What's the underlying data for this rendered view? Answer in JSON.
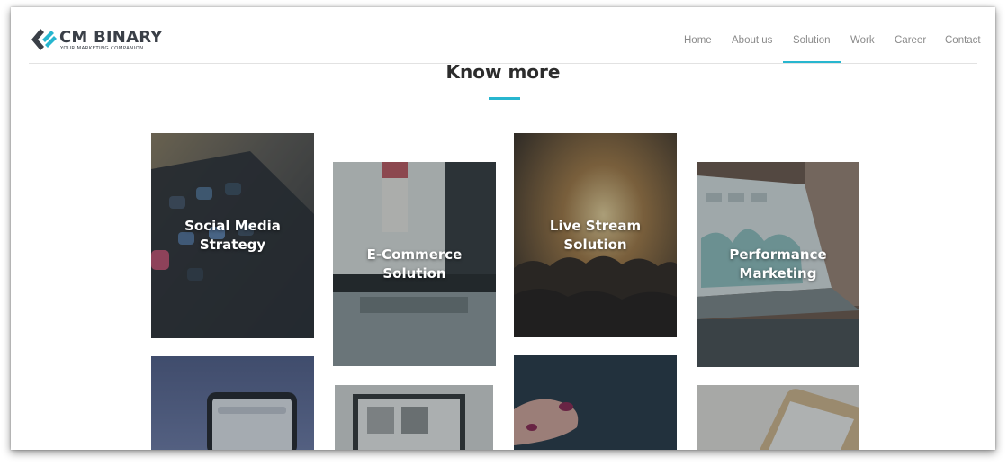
{
  "brand": {
    "name": "CM BINARY",
    "tagline": "YOUR MARKETING COMPANION",
    "colors": {
      "accent": "#27b6cf",
      "logo_dark": "#3a3f47",
      "logo_teal": "#27b6cf"
    }
  },
  "nav": {
    "items": [
      {
        "label": "Home",
        "active": false
      },
      {
        "label": "About us",
        "active": false
      },
      {
        "label": "Solution",
        "active": true
      },
      {
        "label": "Work",
        "active": false
      },
      {
        "label": "Career",
        "active": false
      },
      {
        "label": "Contact",
        "active": false
      }
    ]
  },
  "section": {
    "title": "Know more"
  },
  "tiles": [
    {
      "label": "Social Media Strategy",
      "image": "phone-apps"
    },
    {
      "label": "E-Commerce Solution",
      "image": "laptop-fashion"
    },
    {
      "label": "Live Stream Solution",
      "image": "concert-crowd"
    },
    {
      "label": "Performance Marketing",
      "image": "laptop-analytics"
    },
    {
      "label": "",
      "image": "phone-search"
    },
    {
      "label": "",
      "image": "laptop-gallery"
    },
    {
      "label": "",
      "image": "hand-nails"
    },
    {
      "label": "",
      "image": "phone-gold"
    }
  ]
}
